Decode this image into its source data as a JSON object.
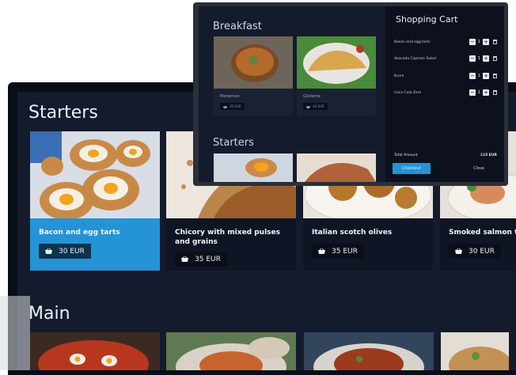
{
  "menu": {
    "starters_title": "Starters",
    "main_title": "Main",
    "starters": [
      {
        "name": "Bacon and egg tarts",
        "price": "30 EUR",
        "selected": true
      },
      {
        "name": "Chicory with mixed pulses and grains",
        "price": "35 EUR",
        "selected": false
      },
      {
        "name": "Italian scotch olives",
        "price": "35 EUR",
        "selected": false
      },
      {
        "name": "Smoked salmon ta",
        "price": "30 EUR",
        "selected": false
      }
    ]
  },
  "overlay": {
    "breakfast_title": "Breakfast",
    "starters_title": "Starters",
    "breakfast_items": [
      {
        "name": "Menemen",
        "price": "30 EUR"
      },
      {
        "name": "Gözleme",
        "price": "30 EUR"
      }
    ]
  },
  "cart": {
    "title": "Shopping Cart",
    "items": [
      {
        "name": "Bacon and egg tarts",
        "qty": "1"
      },
      {
        "name": "Avocado Caprese Salad",
        "qty": "1"
      },
      {
        "name": "Kısırlı",
        "qty": "1"
      },
      {
        "name": "Coca Cola Zero",
        "qty": "1"
      }
    ],
    "minus": "−",
    "plus": "+",
    "total_label": "Total Amount",
    "total_value": "115 EUR",
    "checkout_label": "Checkout",
    "close_label": "Close"
  },
  "colors": {
    "accent": "#2494d6",
    "background": "#141b2c",
    "card": "#0f1524"
  }
}
